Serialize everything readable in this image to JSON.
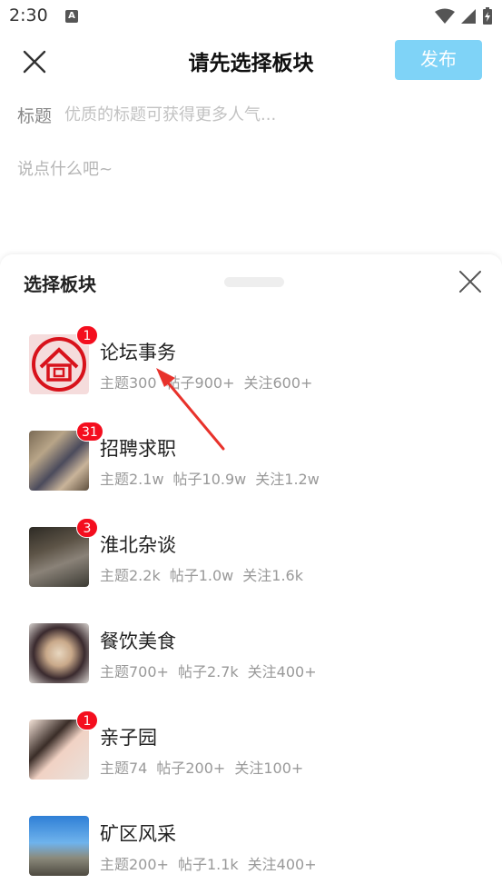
{
  "status": {
    "time": "2:30",
    "a_icon_text": "A"
  },
  "header": {
    "title": "请先选择板块",
    "publish_label": "发布"
  },
  "form": {
    "title_label": "标题",
    "title_placeholder": "优质的标题可获得更多人气...",
    "content_placeholder": "说点什么吧~"
  },
  "sheet": {
    "title": "选择板块",
    "boards": [
      {
        "name": "论坛事务",
        "badge": "1",
        "topics": "主题300",
        "posts": "帖子900+",
        "follows": "关注600+"
      },
      {
        "name": "招聘求职",
        "badge": "31",
        "topics": "主题2.1w",
        "posts": "帖子10.9w",
        "follows": "关注1.2w"
      },
      {
        "name": "淮北杂谈",
        "badge": "3",
        "topics": "主题2.2k",
        "posts": "帖子1.0w",
        "follows": "关注1.6k"
      },
      {
        "name": "餐饮美食",
        "badge": "",
        "topics": "主题700+",
        "posts": "帖子2.7k",
        "follows": "关注400+"
      },
      {
        "name": "亲子园",
        "badge": "1",
        "topics": "主题74",
        "posts": "帖子200+",
        "follows": "关注100+"
      },
      {
        "name": "矿区风采",
        "badge": "",
        "topics": "主题200+",
        "posts": "帖子1.1k",
        "follows": "关注400+"
      }
    ]
  },
  "colors": {
    "accent": "#7fd3f7",
    "badge": "#f40e1e",
    "arrow": "#e8322b"
  }
}
